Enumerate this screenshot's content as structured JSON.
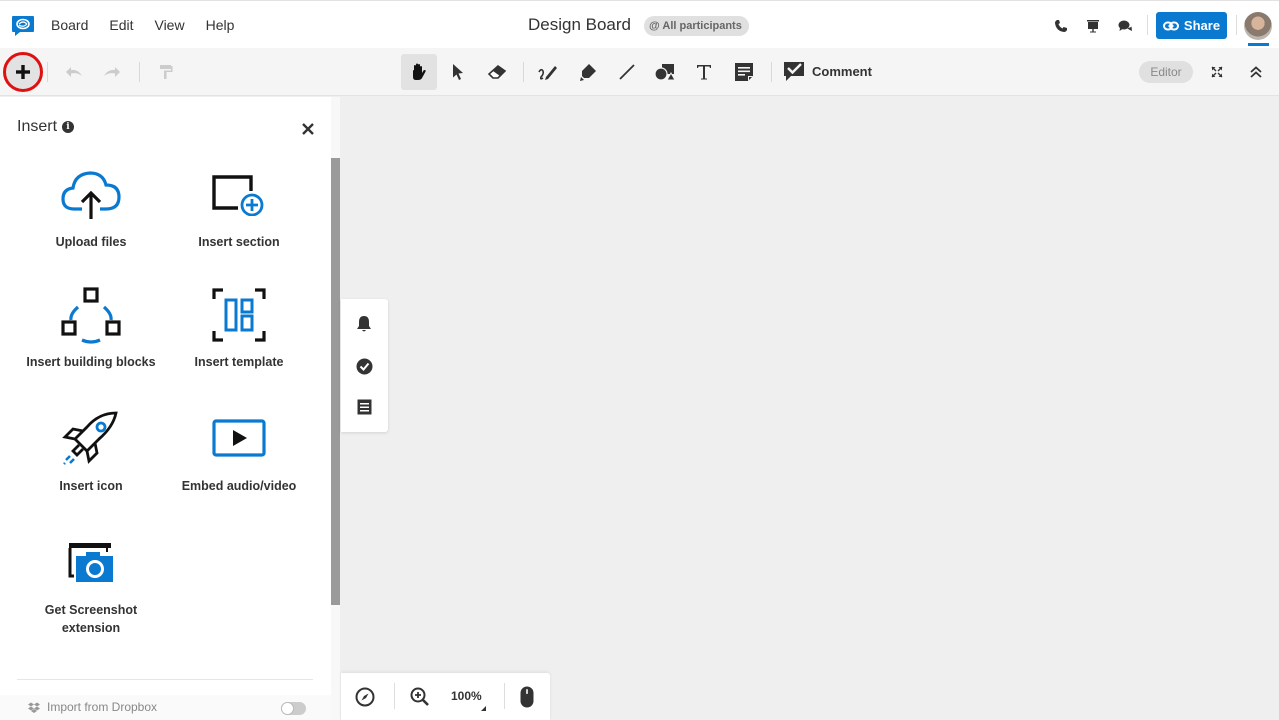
{
  "app": {
    "logo_icon": "chat-bubble-logo-icon",
    "brand_color": "#0a7ad0",
    "highlight_color": "#e01010"
  },
  "menu": {
    "items": [
      "Board",
      "Edit",
      "View",
      "Help"
    ]
  },
  "header": {
    "title": "Design Board",
    "participants_badge": "@ All participants",
    "icons": [
      "phone-icon",
      "presentation-icon",
      "chat-icon"
    ],
    "share_label": "Share",
    "share_icon": "link-icon",
    "avatar": "user-avatar"
  },
  "toolbar": {
    "left": [
      "insert-plus-icon",
      "undo-icon",
      "redo-icon",
      "format-painter-icon"
    ],
    "tools": [
      "hand-icon",
      "select-pointer-icon",
      "eraser-icon",
      "pen-icon",
      "highlighter-icon",
      "line-icon",
      "shapes-icon",
      "text-icon",
      "sticky-note-icon"
    ],
    "active_tool": "hand-icon",
    "comment_label": "Comment",
    "role_badge": "Editor",
    "right": [
      "fullscreen-icon",
      "collapse-icon"
    ]
  },
  "insert_panel": {
    "title": "Insert",
    "items": [
      {
        "label": "Upload files",
        "icon": "cloud-upload-icon"
      },
      {
        "label": "Insert section",
        "icon": "section-add-icon"
      },
      {
        "label": "Insert building blocks",
        "icon": "building-blocks-icon"
      },
      {
        "label": "Insert template",
        "icon": "template-icon"
      },
      {
        "label": "Insert icon",
        "icon": "rocket-icon"
      },
      {
        "label": "Embed audio/video",
        "icon": "video-play-icon"
      },
      {
        "label": "Get Screenshot extension",
        "icon": "screenshot-camera-icon"
      }
    ],
    "dropbox_label": "Import from Dropbox",
    "dropbox_enabled": false
  },
  "side_panel": {
    "icons": [
      "notification-bell-icon",
      "tasks-check-icon",
      "list-icon"
    ]
  },
  "zoom_bar": {
    "zoom_level": "100%",
    "icons": [
      "navigator-compass-icon",
      "zoom-in-icon",
      "mouse-icon"
    ]
  }
}
